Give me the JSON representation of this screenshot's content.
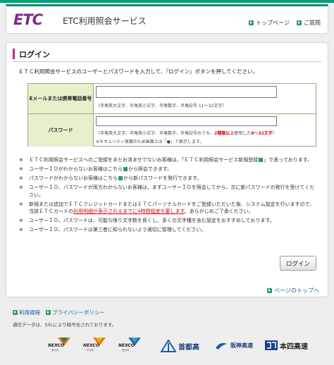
{
  "header": {
    "logo_text": "ETC",
    "service_name": "ETC利用照会サービス",
    "top_page_link": "トップページ",
    "faq_link": "ご質問"
  },
  "login": {
    "title": "ログイン",
    "intro": "ＥＴＣ利用照会サービスのユーザーとパスワードを入力して、『ログイン』ボタンを押してください。",
    "email_label": "Eメールまたは携帯電話番号",
    "email_value": "",
    "email_hint": "（半角英大文字、半角英小文字、半角数字、半角記号 11～32文字）",
    "password_label": "パスワード",
    "password_value": "",
    "password_hint_a": "（半角英大文字、半角英小文字、半角数字、半角記号のうち、",
    "password_hint_b": "2種類以上",
    "password_hint_c": "使用した",
    "password_hint_d": "8～32文字",
    "password_hint_e": "）",
    "password_hint2": "※セキュリティ保護のため画面上は「●」で表示します。",
    "login_button": "ログイン"
  },
  "notes": {
    "mark": "※",
    "n1a": "ＥＴＣ利用照会サービスへのご登録をまだお済ませでないお客様は、「ＥＴＣ利用照会サービス新規登録",
    "n1b": "」で承っております。",
    "n2a": "ユーザーＩＤがわからないお客様はこちら",
    "n2b": "から照会できます。",
    "n3a": "パスワードがわからないお客様はこちら",
    "n3b": "から新パスワードを発行できます。",
    "n4": "ユーザーＩＤ、パスワードが両方わからないお客様は、まずユーザーＩＤを照会してから、次に新パスワードの発行を受けてください。",
    "n5a": "新規または追加でＥＴＣクレジットカードまたはＥＴＣパーソナルカードをご登録いただいた後、システム設定を行いますので、当該ＥＴＣカードの",
    "n5b": "利用明細が表示されるまでに4時間程度を要します",
    "n5c": "。あらかじめご了承ください。",
    "n6": "ユーザーＩＤ、パスワードは、可能な限り文字数を長くし、多くの文字種を含む設定をおすすめしております。",
    "n7": "ユーザーＩＤ、パスワードは第三者に知られないよう適切に管理してください。"
  },
  "page_top_link": "ページのトップへ",
  "footer": {
    "terms_link": "利用規程",
    "privacy_link": "プライバシーポリシー",
    "ssl_note": "通信データは、SSLにより暗号化されております。"
  },
  "logos": {
    "nexco_text": "NEXCO",
    "nexco_east_sub": "東日本",
    "nexco_central_sub": "中日本",
    "nexco_west_sub": "西日本",
    "shutoko": "首都高",
    "hanshin": "阪神高速",
    "honshi": "本四高速"
  },
  "colors": {
    "brand_green": "#0a8d6f",
    "accent_magenta": "#b72b8c",
    "table_label_bg": "#e6f1cc",
    "alert_red": "#d0121b"
  }
}
